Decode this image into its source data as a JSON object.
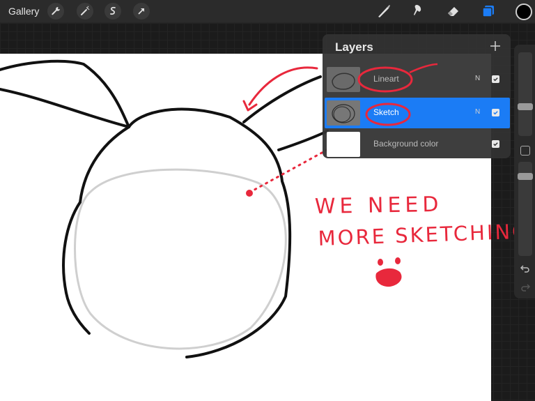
{
  "topbar": {
    "gallery_label": "Gallery",
    "left_tools": [
      "wrench-icon",
      "magic-wand-icon",
      "selection-icon",
      "transform-arrow-icon"
    ],
    "right_tools": [
      "brush-icon",
      "smudge-icon",
      "eraser-icon",
      "layers-icon"
    ],
    "current_color": "#000000",
    "accent_color": "#1b7cf5"
  },
  "layers_panel": {
    "title": "Layers",
    "layers": [
      {
        "name": "Lineart",
        "blend_mode": "N",
        "visible": true,
        "selected": false
      },
      {
        "name": "Sketch",
        "blend_mode": "N",
        "visible": true,
        "selected": true
      },
      {
        "name": "Background color",
        "blend_mode": "",
        "visible": true,
        "selected": false
      }
    ]
  },
  "annotation": {
    "line1": "WE NEED",
    "line2": "MORE SKETCHING",
    "color": "#e8283c"
  }
}
